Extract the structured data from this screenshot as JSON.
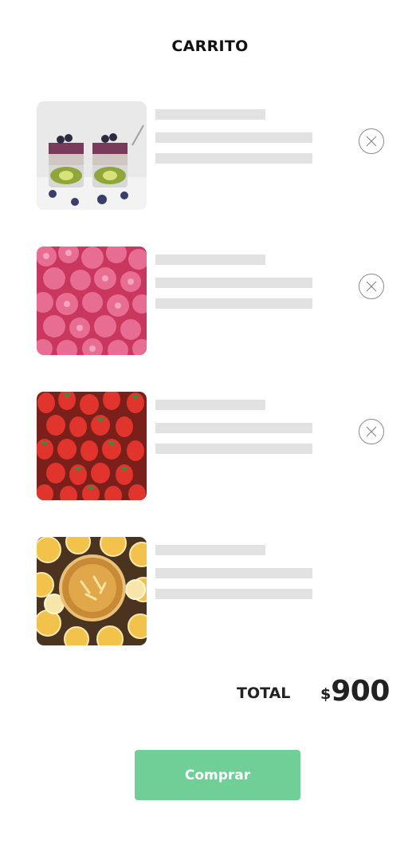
{
  "header": {
    "title": "CARRITO"
  },
  "cart": {
    "items": [
      {
        "image": "chia-kiwi-parfait-photo",
        "removable": true
      },
      {
        "image": "raspberries-photo",
        "removable": true
      },
      {
        "image": "strawberries-photo",
        "removable": true
      },
      {
        "image": "citrus-slices-drink-photo",
        "removable": false
      }
    ]
  },
  "summary": {
    "total_label": "TOTAL",
    "currency": "$",
    "total_value": "900"
  },
  "actions": {
    "buy_label": "Comprar"
  },
  "colors": {
    "primary_button": "#6fcf97",
    "placeholder": "#e2e2e2",
    "text": "#222222"
  },
  "icons": {
    "remove": "close-circle-icon"
  }
}
